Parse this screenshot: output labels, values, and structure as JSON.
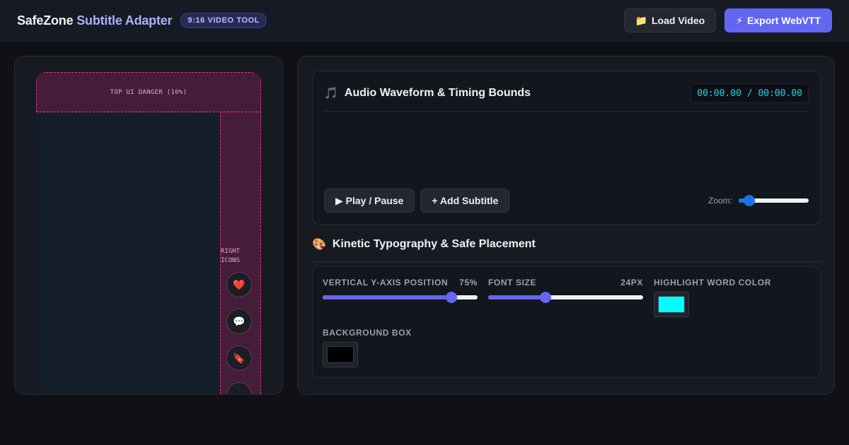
{
  "header": {
    "brand_part1": "SafeZone",
    "brand_part2": "Subtitle Adapter",
    "badge": "9:16 VIDEO TOOL",
    "load_video_icon": "📁",
    "load_video_label": "Load Video",
    "export_icon": "⚡",
    "export_label": "Export WebVTT"
  },
  "preview": {
    "top_danger_label": "TOP UI DANGER (10%)",
    "right_label_line1": "RIGHT",
    "right_label_line2": "ICONS",
    "icons": [
      {
        "name": "heart-icon",
        "glyph": "❤️"
      },
      {
        "name": "comment-icon",
        "glyph": "💬"
      },
      {
        "name": "bookmark-icon",
        "glyph": "🔖"
      }
    ]
  },
  "audio": {
    "title_icon": "🎵",
    "title": "Audio Waveform & Timing Bounds",
    "timecode": "00:00.00 / 00:00.00",
    "play_label": "▶ Play / Pause",
    "add_subtitle_label": "+ Add Subtitle",
    "zoom_label": "Zoom:",
    "zoom_level": 0.15
  },
  "typography": {
    "title_icon": "🎨",
    "title": "Kinetic Typography & Safe Placement",
    "y_position_label": "Vertical Y-Axis Position",
    "y_position_value": "75%",
    "y_position_level": 0.83,
    "font_size_label": "Font Size",
    "font_size_value": "24px",
    "font_size_level": 0.37,
    "highlight_label": "Highlight Word Color",
    "highlight_color": "#00ffff",
    "background_label": "Background Box",
    "background_color": "#000000"
  },
  "colors": {
    "accent": "#6366f1",
    "timecode": "#22d3ee",
    "danger": "#e0407d"
  }
}
